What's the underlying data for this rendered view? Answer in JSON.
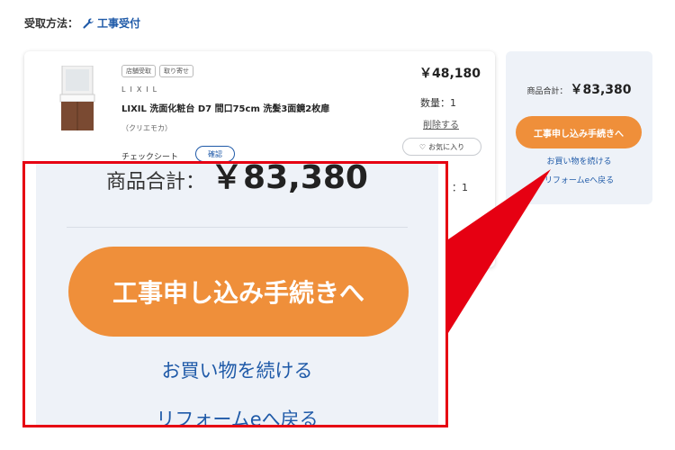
{
  "receipt": {
    "label": "受取方法：",
    "value": "工事受付",
    "icon": "wrench-icon"
  },
  "cart_item": {
    "badges": [
      "店舗受取",
      "取り寄せ"
    ],
    "brand": "LIXIL",
    "name": "LIXIL 洗面化粧台 D7 間口75cm 洗髪3面鏡2枚扉",
    "color": "（クリエモカ）",
    "price": "￥48,180",
    "quantity": "数量：1",
    "quantity_second": "：1",
    "delete_label": "削除する",
    "favorite_label": "お気に入り",
    "check_sheet_label": "チェックシート",
    "confirm_label": "確認"
  },
  "summary": {
    "total_label": "商品合計：",
    "total_value": "￥83,380",
    "proceed_label": "工事申し込み手続きへ",
    "continue_label": "お買い物を続ける",
    "return_label": "リフォームeへ戻る"
  },
  "colors": {
    "accent_orange": "#ef8f3a",
    "link_blue": "#1f5aa8",
    "highlight_red": "#e60012",
    "summary_bg": "#eef2f8"
  }
}
